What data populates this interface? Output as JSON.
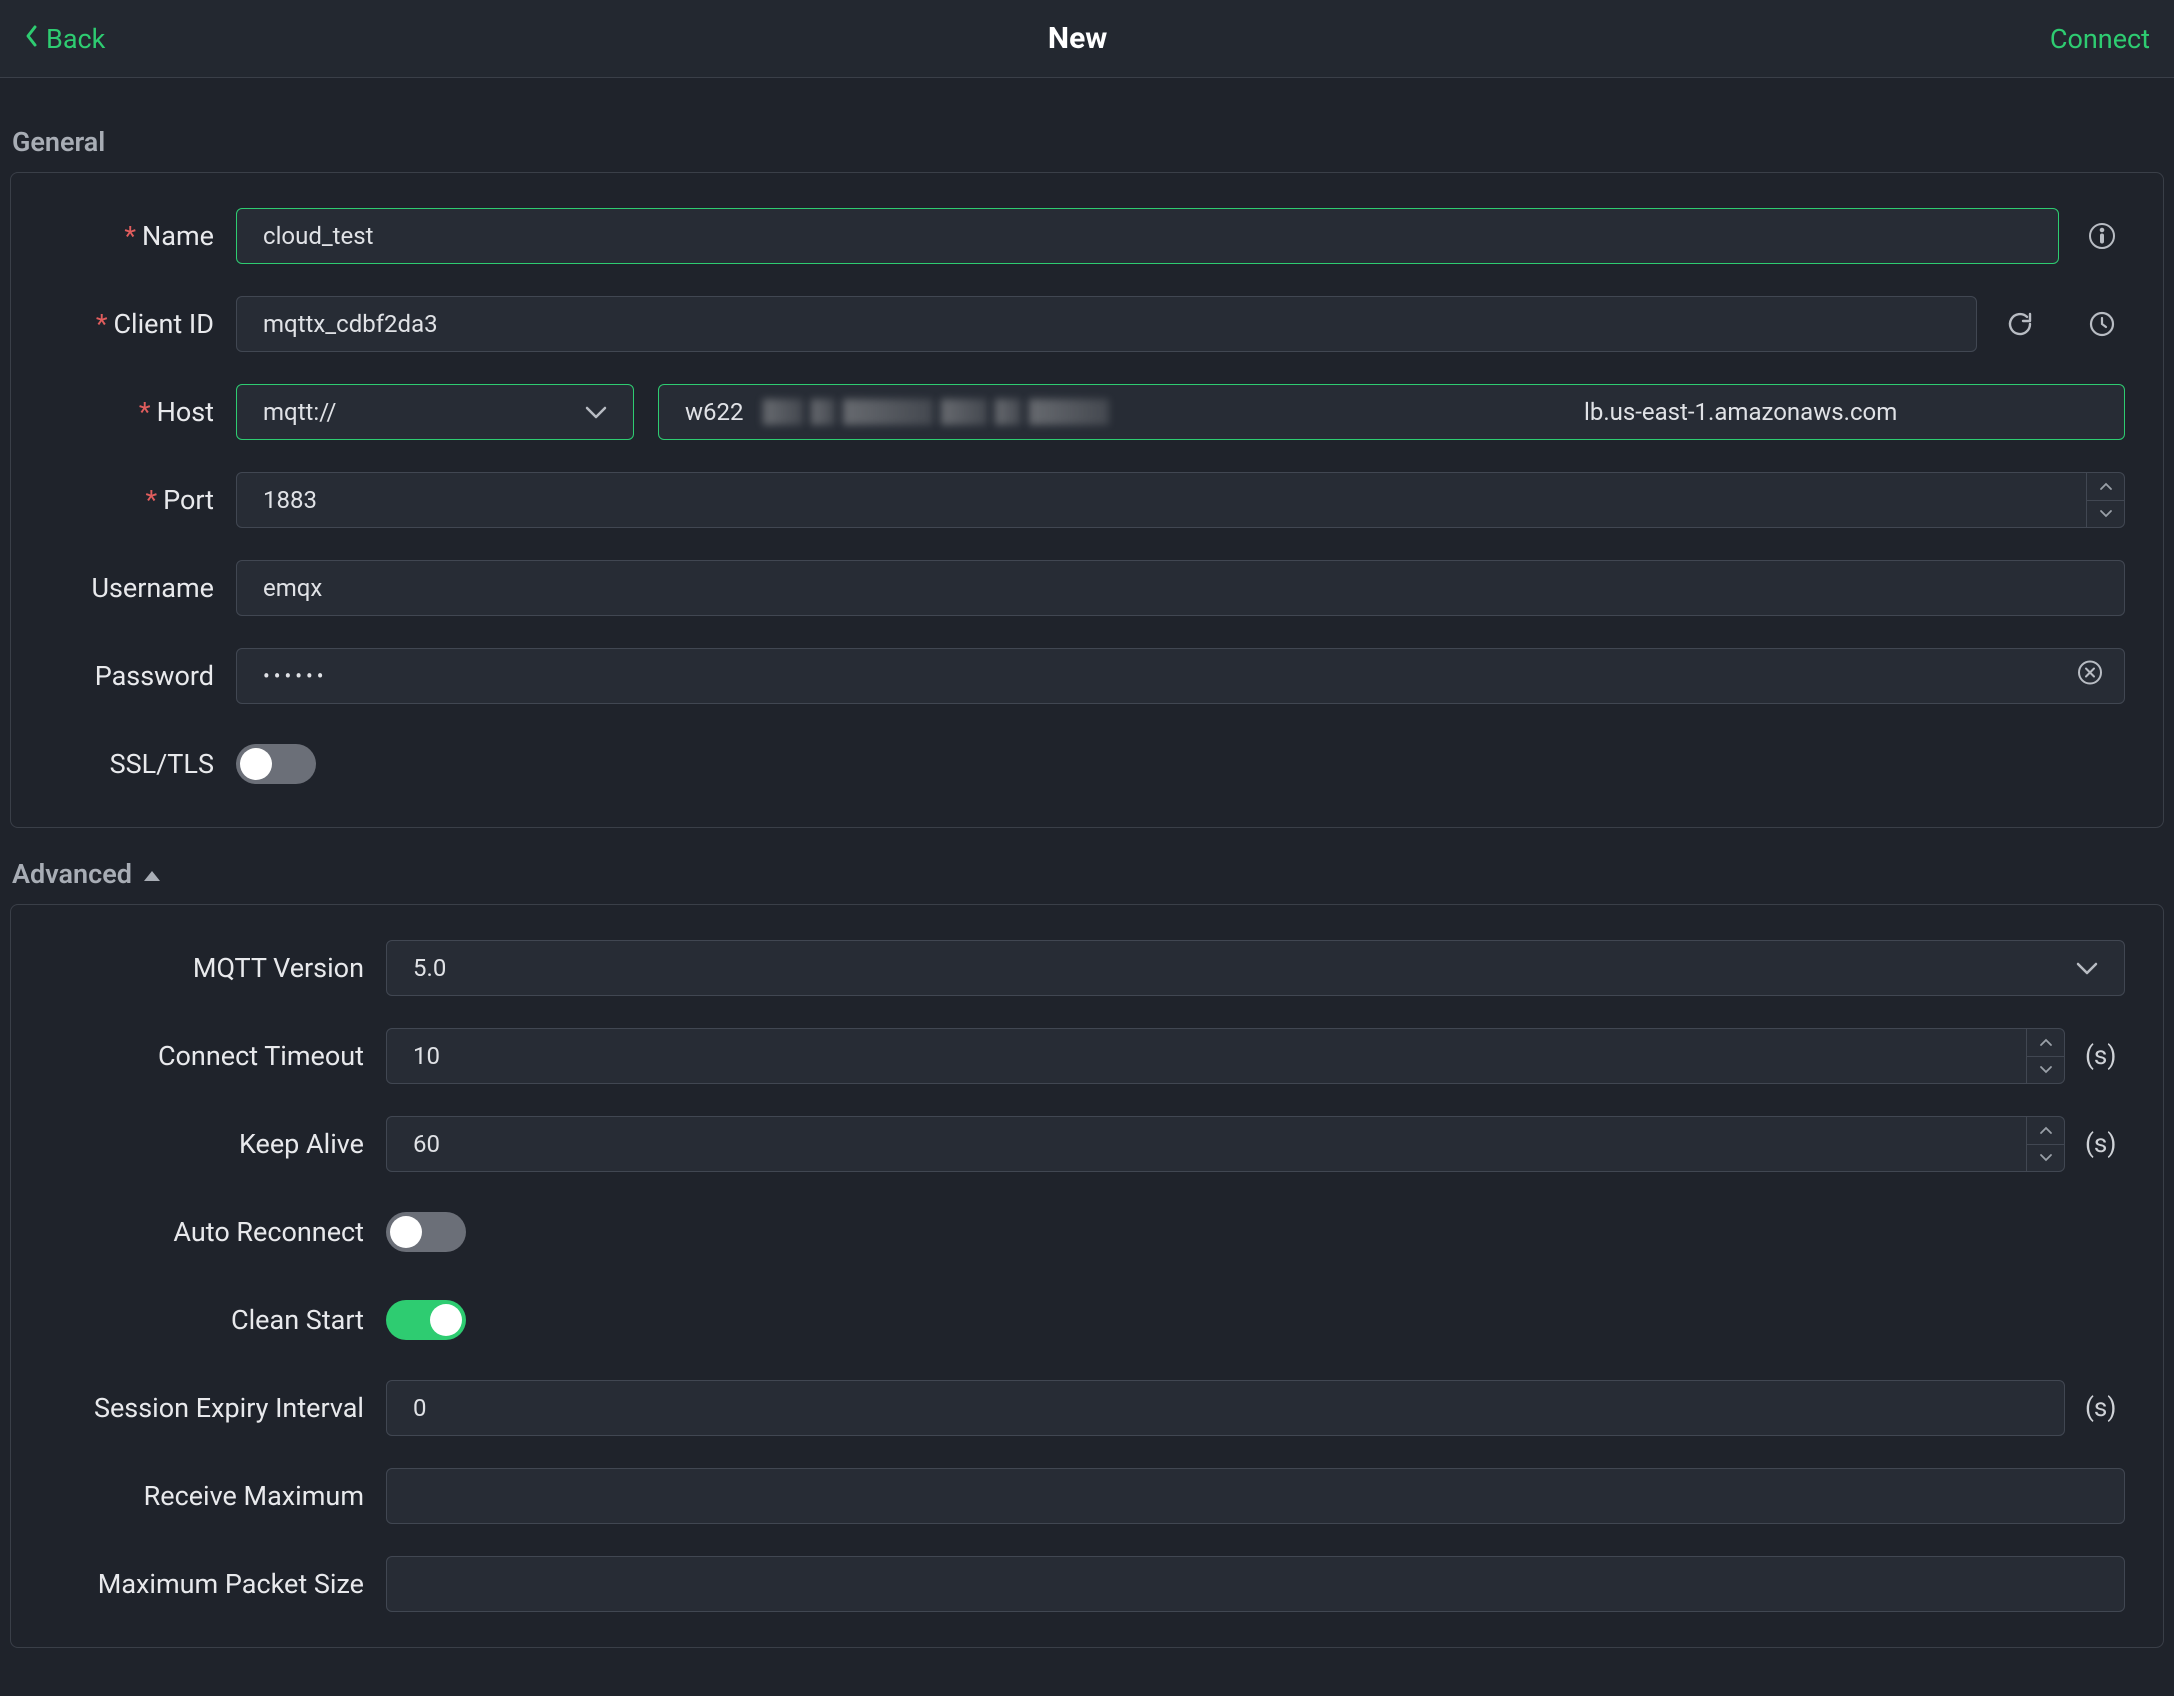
{
  "header": {
    "back_label": "Back",
    "title": "New",
    "connect_label": "Connect"
  },
  "sections": {
    "general_title": "General",
    "advanced_title": "Advanced"
  },
  "general": {
    "name": {
      "label": "Name",
      "value": "cloud_test",
      "required": true
    },
    "client_id": {
      "label": "Client ID",
      "value": "mqttx_cdbf2da3",
      "required": true
    },
    "host": {
      "label": "Host",
      "protocol_value": "mqtt://",
      "prefix_value": "w622",
      "suffix_value": "lb.us-east-1.amazonaws.com",
      "required": true
    },
    "port": {
      "label": "Port",
      "value": "1883",
      "required": true
    },
    "username": {
      "label": "Username",
      "value": "emqx"
    },
    "password": {
      "label": "Password",
      "value": "••••••"
    },
    "ssl": {
      "label": "SSL/TLS",
      "on": false
    }
  },
  "advanced": {
    "mqtt_version": {
      "label": "MQTT Version",
      "value": "5.0"
    },
    "connect_timeout": {
      "label": "Connect Timeout",
      "value": "10",
      "unit": "(s)"
    },
    "keep_alive": {
      "label": "Keep Alive",
      "value": "60",
      "unit": "(s)"
    },
    "auto_reconnect": {
      "label": "Auto Reconnect",
      "on": false
    },
    "clean_start": {
      "label": "Clean Start",
      "on": true
    },
    "session_expiry": {
      "label": "Session Expiry Interval",
      "value": "0",
      "unit": "(s)"
    },
    "receive_max": {
      "label": "Receive Maximum",
      "value": ""
    },
    "max_packet": {
      "label": "Maximum Packet Size",
      "value": ""
    }
  },
  "asterisk": "*"
}
